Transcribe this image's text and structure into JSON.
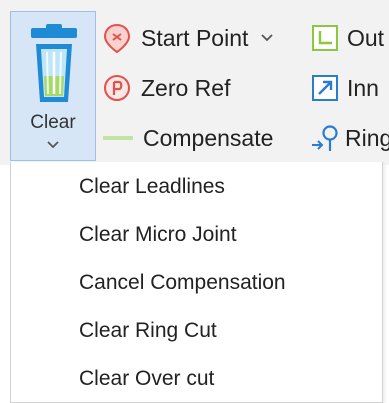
{
  "ribbon": {
    "clear_button": {
      "label": "Clear"
    },
    "commands": {
      "start_point": "Start Point",
      "zero_ref": "Zero Ref",
      "compensate": "Compensate",
      "outer": "Out",
      "inner": "Inn",
      "ring": "Ring"
    }
  },
  "menu": {
    "items": [
      "Clear Leadlines",
      "Clear Micro Joint",
      "Cancel Compensation",
      "Clear Ring Cut",
      "Clear Over cut"
    ]
  },
  "colors": {
    "ribbon_background": "#f2f2f2",
    "clear_button_highlight": "#d7e6f6",
    "clear_button_border": "#9ec0e6",
    "red_icon": "#e2514b",
    "green_icon": "#8dc63f",
    "blue_icon": "#2b7bd1"
  }
}
